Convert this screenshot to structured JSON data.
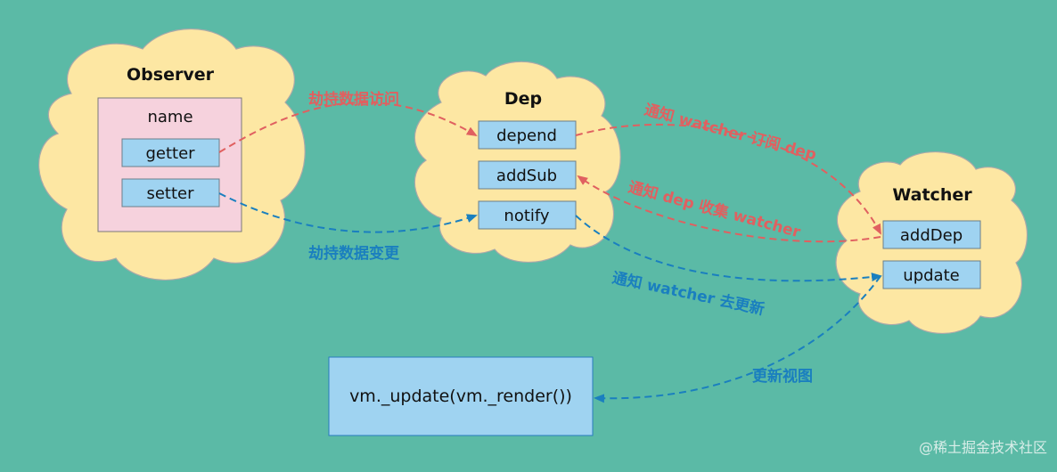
{
  "observer": {
    "title": "Observer",
    "group_label": "name",
    "items": [
      "getter",
      "setter"
    ]
  },
  "dep": {
    "title": "Dep",
    "items": [
      "depend",
      "addSub",
      "notify"
    ]
  },
  "watcher": {
    "title": "Watcher",
    "items": [
      "addDep",
      "update"
    ]
  },
  "render_box": "vm._update(vm._render())",
  "edges": {
    "getter_to_depend": "劫持数据访问",
    "setter_to_notify": "劫持数据变更",
    "depend_to_adddep": "通知 watcher 订阅 dep",
    "adddep_to_addsub": "通知 dep 收集 watcher",
    "notify_to_update": "通知 watcher 去更新",
    "update_to_render": "更新视图"
  },
  "watermark": "@稀土掘金技术社区",
  "colors": {
    "background": "#5bbaa6",
    "cloud": "#fde7a3",
    "observer_group": "#f6d2dd",
    "box": "#9fd3f1",
    "red_arrow": "#e06060",
    "blue_arrow": "#1a7fbf"
  }
}
